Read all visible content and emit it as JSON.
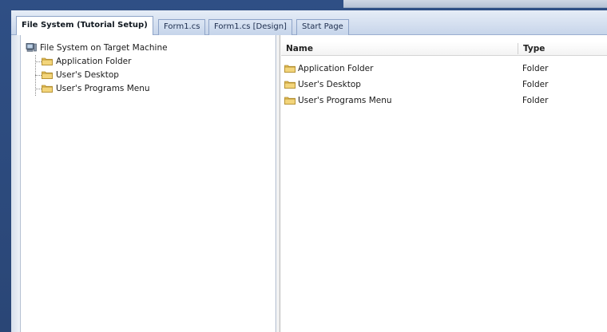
{
  "tabs": [
    {
      "label": "File System (Tutorial Setup)",
      "active": true
    },
    {
      "label": "Form1.cs",
      "active": false
    },
    {
      "label": "Form1.cs [Design]",
      "active": false
    },
    {
      "label": "Start Page",
      "active": false
    }
  ],
  "tree": {
    "root": {
      "label": "File System on Target Machine",
      "icon": "computer-icon"
    },
    "children": [
      {
        "label": "Application Folder",
        "icon": "folder-icon"
      },
      {
        "label": "User's Desktop",
        "icon": "folder-icon"
      },
      {
        "label": "User's Programs Menu",
        "icon": "folder-icon"
      }
    ]
  },
  "list": {
    "columns": [
      "Name",
      "Type"
    ],
    "rows": [
      {
        "name": "Application Folder",
        "type": "Folder",
        "icon": "folder-icon"
      },
      {
        "name": "User's Desktop",
        "type": "Folder",
        "icon": "folder-icon"
      },
      {
        "name": "User's Programs Menu",
        "type": "Folder",
        "icon": "folder-icon"
      }
    ]
  },
  "colors": {
    "frame": "#2b4a7c",
    "folder": "#e8c25a",
    "tab_border": "#8ea4c8"
  }
}
